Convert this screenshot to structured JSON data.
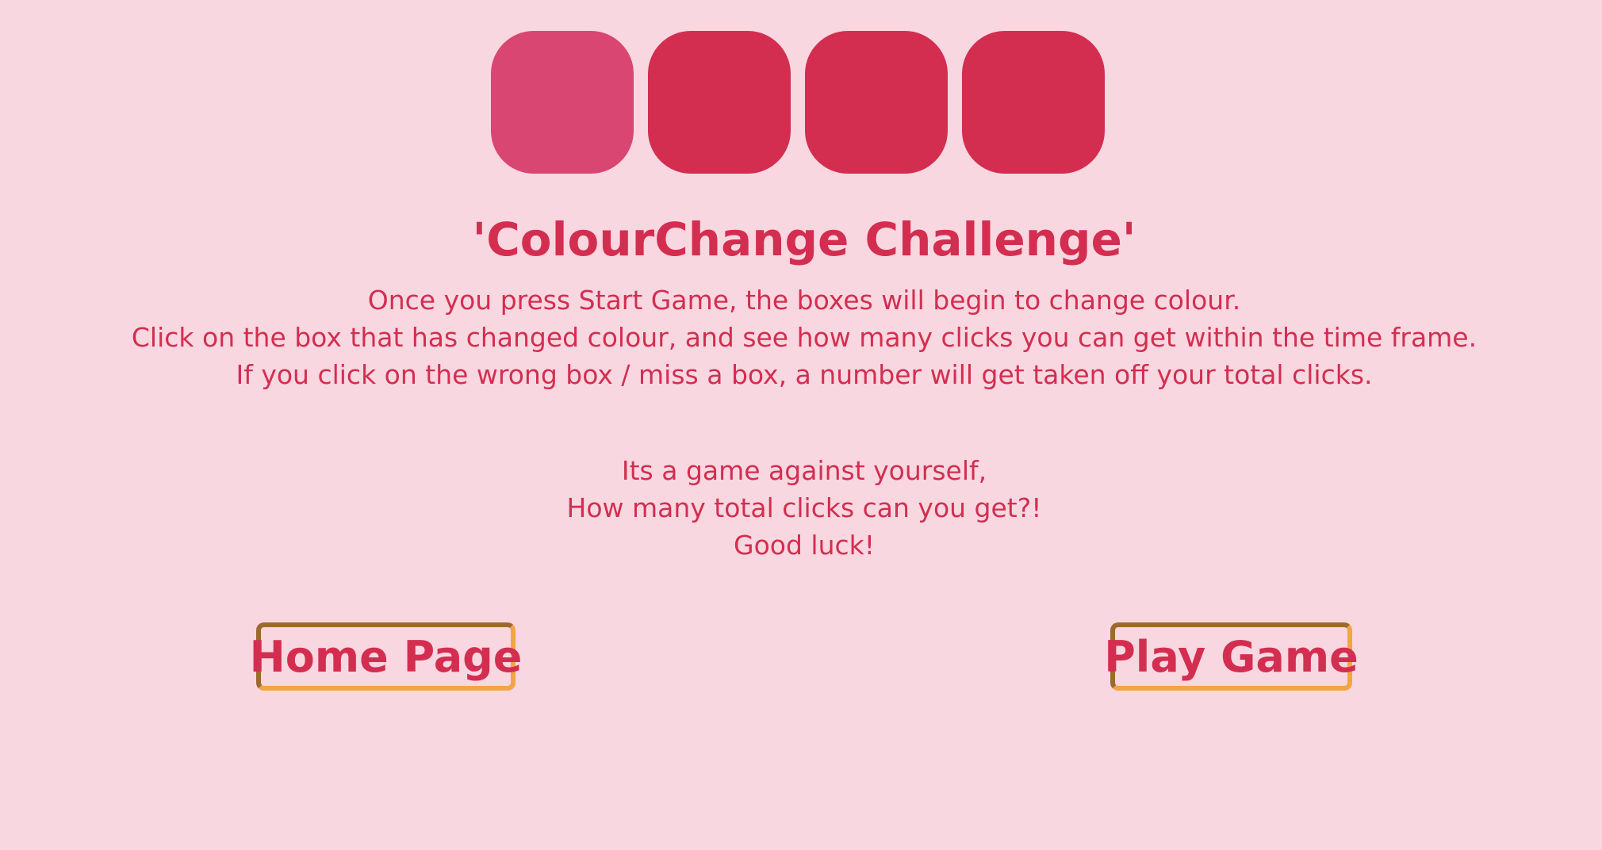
{
  "game": {
    "boxes": [
      {
        "label": "box-1",
        "state": "changed",
        "color": "#d94672"
      },
      {
        "label": "box-2",
        "state": "default",
        "color": "#d32e50"
      },
      {
        "label": "box-3",
        "state": "default",
        "color": "#d32e50"
      },
      {
        "label": "box-4",
        "state": "default",
        "color": "#d32e50"
      }
    ]
  },
  "content": {
    "title": "'ColourChange Challenge'",
    "instructions": [
      "Once you press Start Game, the boxes will begin to change colour.",
      "Click on the box that has changed colour, and see how many clicks you can get within the time frame.",
      "If you click on the wrong box / miss a box, a number will get taken off your total clicks."
    ],
    "motivation": [
      "Its a game against yourself,",
      "How many total clicks can you get?!",
      "Good luck!"
    ]
  },
  "buttons": {
    "home_label": "Home Page",
    "play_label": "Play Game"
  },
  "colors": {
    "background": "#f8d7e1",
    "accent": "#d32e50",
    "highlight_box": "#d94672",
    "button_border_light": "#f2a542",
    "button_border_dark": "#9c6a2c"
  }
}
